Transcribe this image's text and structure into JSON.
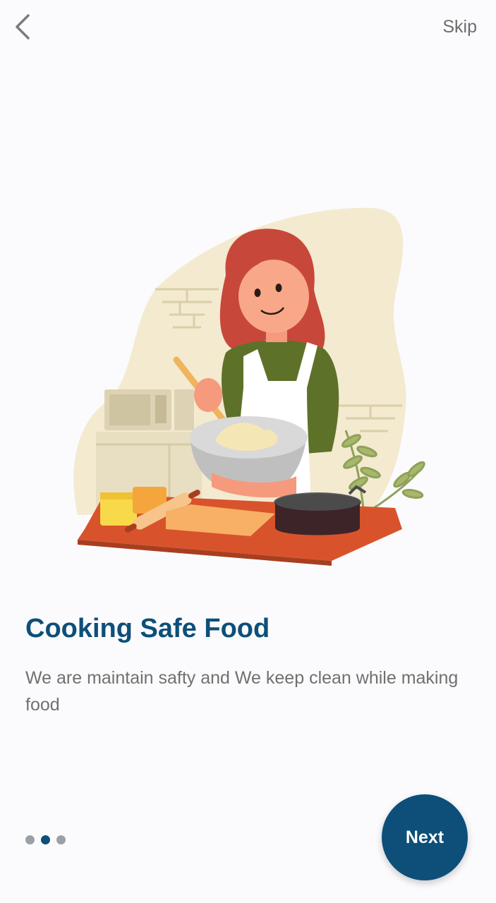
{
  "header": {
    "back_icon": "chevron-left-icon",
    "skip_label": "Skip"
  },
  "onboarding": {
    "illustration": "woman-cooking-illustration",
    "title": "Cooking Safe Food",
    "description": "We are maintain safty and We keep clean while making food",
    "pager": {
      "total": 3,
      "active_index": 1
    }
  },
  "footer": {
    "next_label": "Next"
  },
  "colors": {
    "accent": "#0d4f78",
    "background": "#fbfbfd",
    "text_muted": "#707070",
    "dot_inactive": "#9aa0a6"
  }
}
